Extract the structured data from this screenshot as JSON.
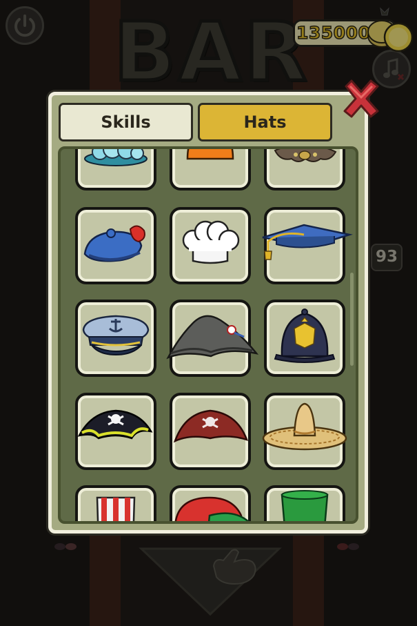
{
  "header": {
    "sign_text": "BAR",
    "coins": "135000",
    "side_counter": "93"
  },
  "tabs": [
    {
      "label": "Skills",
      "active": false
    },
    {
      "label": "Hats",
      "active": true
    }
  ],
  "hats": [
    {
      "icon": "bubble-hat-icon"
    },
    {
      "icon": "orange-hardhat-icon"
    },
    {
      "icon": "medusa-hat-icon"
    },
    {
      "icon": "blue-beret-icon"
    },
    {
      "icon": "chef-hat-icon"
    },
    {
      "icon": "graduation-cap-icon"
    },
    {
      "icon": "captain-hat-icon"
    },
    {
      "icon": "bicorne-hat-icon"
    },
    {
      "icon": "police-helmet-icon"
    },
    {
      "icon": "pirate-hat-black-icon"
    },
    {
      "icon": "pirate-hat-red-icon"
    },
    {
      "icon": "sombrero-icon"
    },
    {
      "icon": "uncle-sam-hat-icon"
    },
    {
      "icon": "jester-hat-icon"
    },
    {
      "icon": "green-top-hat-icon"
    }
  ],
  "colors": {
    "panel": "#a5ab82",
    "active_tab": "#dcb535",
    "inactive_tab": "#e9e8d2",
    "grid_bg": "#5f6a47",
    "close_x": "#c8323a",
    "coin_text": "#e3bf2a"
  }
}
